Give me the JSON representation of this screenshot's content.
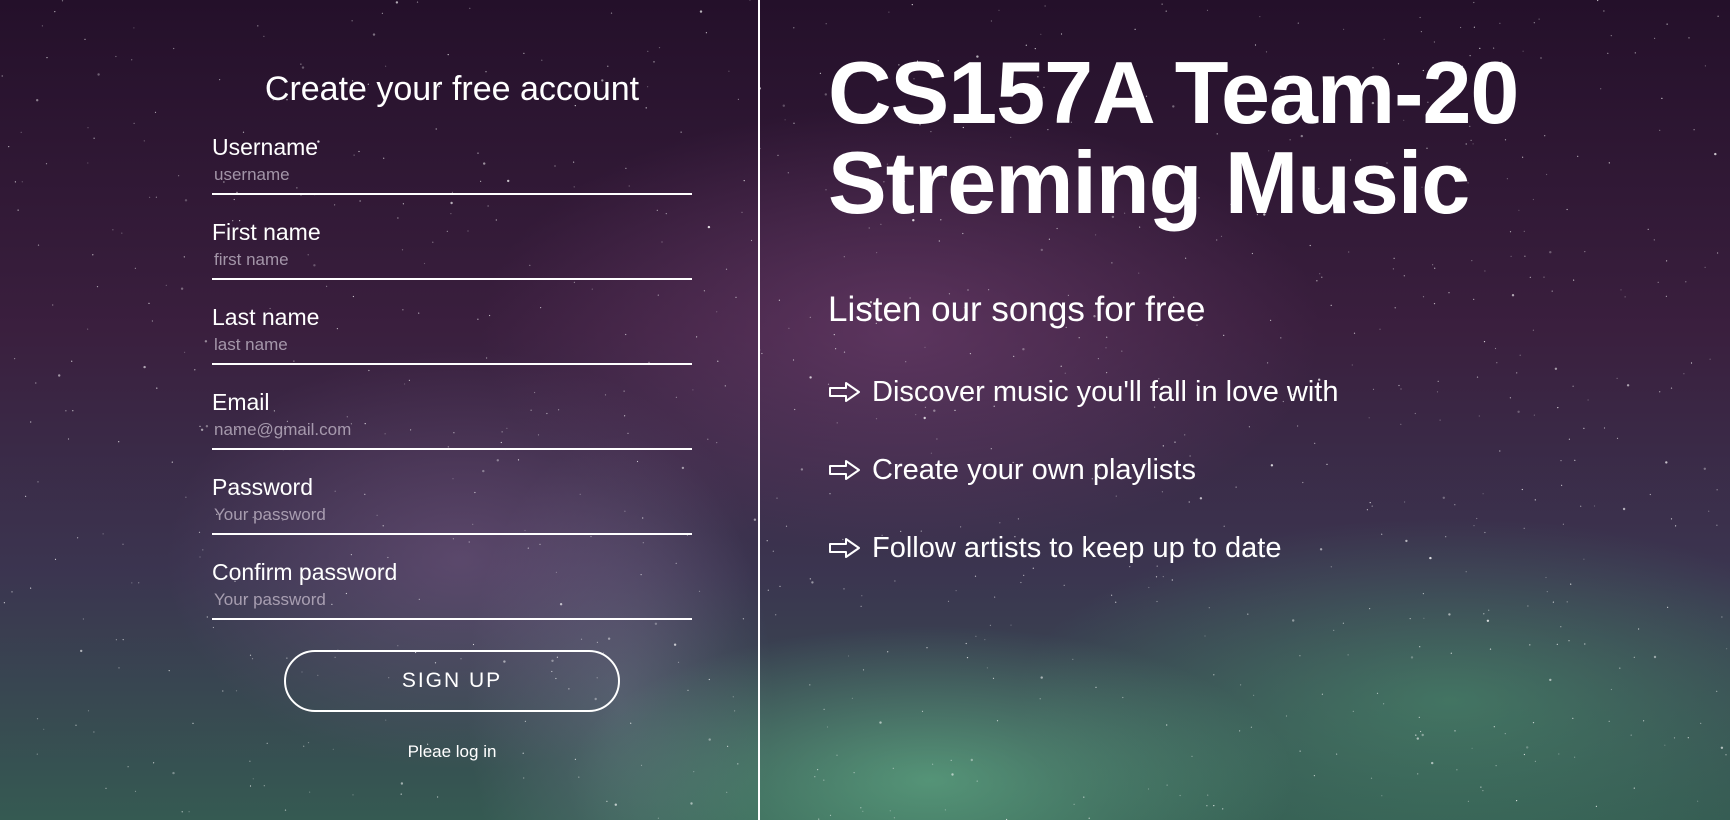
{
  "signup_form": {
    "title": "Create your free account",
    "fields": [
      {
        "label": "Username",
        "placeholder": "username"
      },
      {
        "label": "First name",
        "placeholder": "first name"
      },
      {
        "label": "Last name",
        "placeholder": "last name"
      },
      {
        "label": "Email",
        "placeholder": "name@gmail.com"
      },
      {
        "label": "Password",
        "placeholder": "Your password"
      },
      {
        "label": "Confirm password",
        "placeholder": "Your password"
      }
    ],
    "submit_label": "SIGN UP",
    "login_link": "Pleae log in"
  },
  "hero": {
    "title_line1": "CS157A Team-20",
    "title_line2": "Streming Music",
    "subtitle": "Listen our songs for free",
    "features": [
      {
        "icon": "right-arrow-icon",
        "text": "Discover music you'll fall in love with"
      },
      {
        "icon": "right-arrow-icon",
        "text": "Create your own playlists"
      },
      {
        "icon": "right-arrow-icon",
        "text": "Follow artists to keep up to date"
      }
    ]
  },
  "colors": {
    "text": "#ffffff",
    "background_top": "#24102a",
    "background_bottom": "#355a52",
    "aurora_green": "#6ec896"
  }
}
